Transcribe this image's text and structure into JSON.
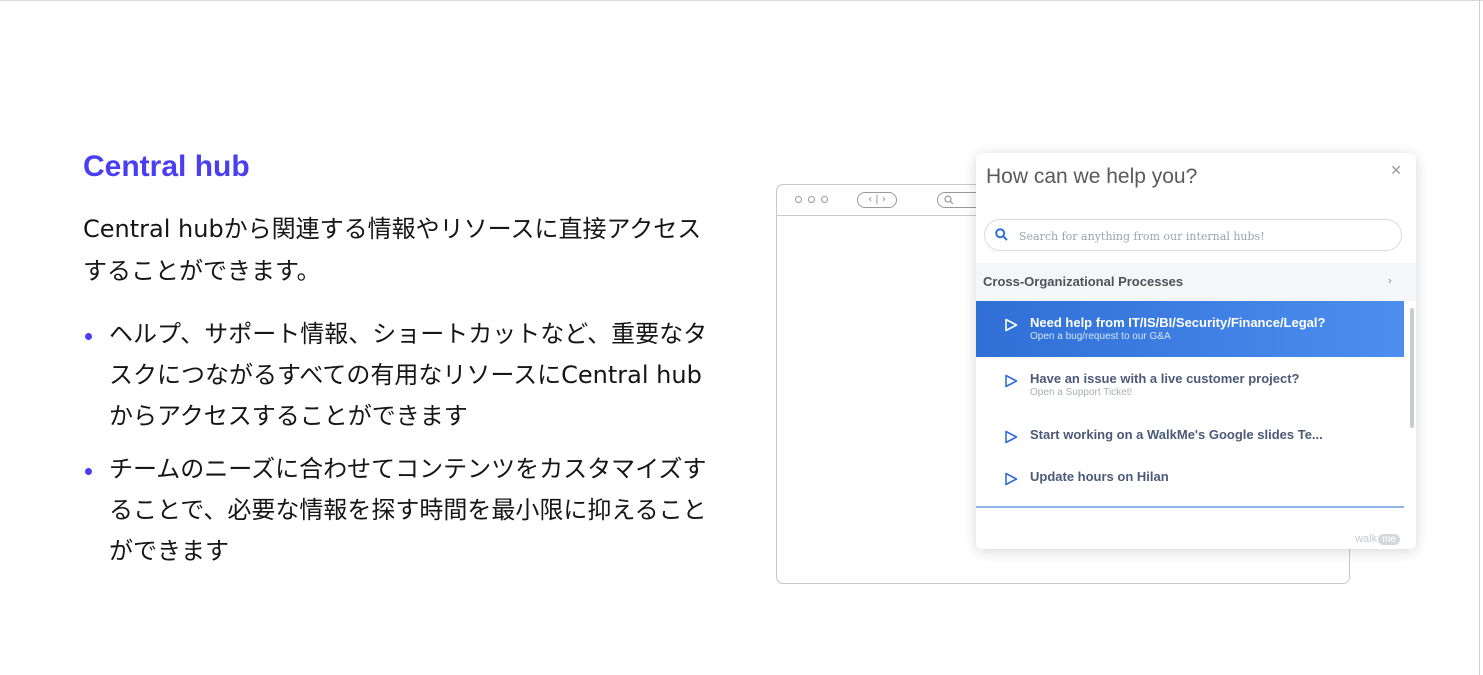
{
  "heading": "Central hub",
  "intro": "Central hubから関連する情報やリソースに直接アクセスすることができます。",
  "bullets": [
    "ヘルプ、サポート情報、ショートカットなど、重要なタスクにつながるすべての有用なリソースにCentral hubからアクセスすることができます",
    "チームのニーズに合わせてコンテンツをカスタマイズすることで、必要な情報を探す時間を最小限に抑えることができます"
  ],
  "widget": {
    "title": "How can we help you?",
    "close_icon": "close-icon",
    "search_placeholder": "Search for anything from our internal hubs!",
    "section": "Cross-Organizational Processes",
    "items": [
      {
        "title": "Need help from IT/IS/BI/Security/Finance/Legal?",
        "subtitle": "Open a bug/request to our G&A",
        "active": true
      },
      {
        "title": "Have an issue with a live customer project?",
        "subtitle": "Open a Support Ticket!"
      },
      {
        "title": "Start working on a WalkMe's Google slides Te...",
        "subtitle": ""
      },
      {
        "title": "Update hours on Hilan",
        "subtitle": ""
      }
    ],
    "brand_text": "walk",
    "brand_badge": "me"
  },
  "colors": {
    "accent": "#4a3ff0",
    "active_item": "#3a7be3",
    "item_text": "#4a5a78"
  }
}
